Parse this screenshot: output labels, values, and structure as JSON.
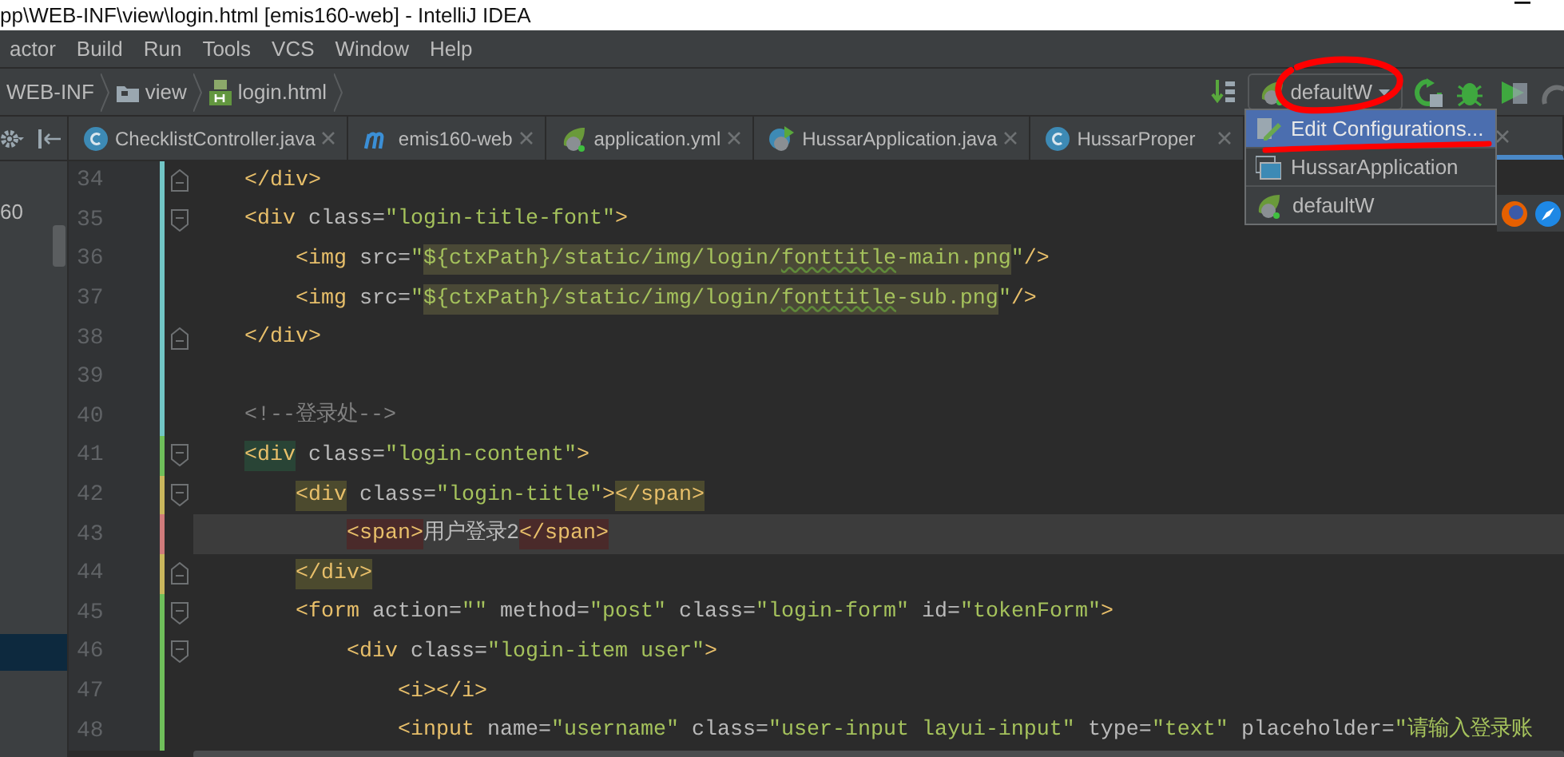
{
  "window": {
    "title": "pp\\WEB-INF\\view\\login.html [emis160-web] - IntelliJ IDEA"
  },
  "menu": [
    "actor",
    "Build",
    "Run",
    "Tools",
    "VCS",
    "Window",
    "Help"
  ],
  "breadcrumbs": [
    {
      "label": "WEB-INF"
    },
    {
      "label": "view",
      "kind": "folder"
    },
    {
      "label": "login.html",
      "kind": "html"
    }
  ],
  "run_config": {
    "label": "defaultW"
  },
  "project_panel": {
    "rows": [
      {
        "label": "60",
        "selected": false
      },
      {
        "selected": false
      },
      {
        "selected": false
      },
      {
        "selected": false
      },
      {
        "selected": false
      },
      {
        "selected": false
      },
      {
        "selected": false
      },
      {
        "selected": false
      },
      {
        "selected": false
      },
      {
        "selected": false
      },
      {
        "selected": false
      },
      {
        "selected": false
      },
      {
        "selected": true
      }
    ]
  },
  "tabs": [
    {
      "label": "ChecklistController.java",
      "kind": "class",
      "selected": false
    },
    {
      "label": "emis160-web",
      "kind": "module",
      "selected": false
    },
    {
      "label": "application.yml",
      "kind": "spring",
      "selected": false
    },
    {
      "label": "HussarApplication.java",
      "kind": "spring-app",
      "selected": false
    },
    {
      "label": "HussarProper",
      "kind": "class",
      "selected": false
    },
    {
      "selected": true
    }
  ],
  "editor": {
    "lines": [
      {
        "number": "34",
        "color": "#72c6c6",
        "kind": "fold-end",
        "current": false,
        "segments": [
          {
            "kind": "tag",
            "text": "    </div>"
          }
        ]
      },
      {
        "number": "35",
        "color": "#72c6c6",
        "kind": "fold-start",
        "current": false,
        "segments": [
          {
            "kind": "tag",
            "text": "    <div"
          },
          {
            "kind": "attr",
            "text": " class="
          },
          {
            "kind": "str",
            "text": "\"login-title-font\""
          },
          {
            "kind": "tag",
            "text": ">"
          }
        ]
      },
      {
        "number": "36",
        "color": "#72c6c6",
        "kind": "plain",
        "current": false,
        "segments": [
          {
            "kind": "tag",
            "text": "        <img"
          },
          {
            "kind": "attr",
            "text": " src="
          },
          {
            "kind": "str",
            "text": "\""
          },
          {
            "kind": "str-injected",
            "text": "${ctxPath}/static/img/login/"
          },
          {
            "kind": "str-typo",
            "text": "fonttitle"
          },
          {
            "kind": "str-injected",
            "text": "-main.png"
          },
          {
            "kind": "str",
            "text": "\""
          },
          {
            "kind": "tag",
            "text": "/>"
          }
        ]
      },
      {
        "number": "37",
        "color": "#72c6c6",
        "kind": "plain",
        "current": false,
        "segments": [
          {
            "kind": "tag",
            "text": "        <img"
          },
          {
            "kind": "attr",
            "text": " src="
          },
          {
            "kind": "str",
            "text": "\""
          },
          {
            "kind": "str-injected",
            "text": "${ctxPath}/static/img/login/"
          },
          {
            "kind": "str-typo",
            "text": "fonttitle"
          },
          {
            "kind": "str-injected",
            "text": "-sub.png"
          },
          {
            "kind": "str",
            "text": "\""
          },
          {
            "kind": "tag",
            "text": "/>"
          }
        ]
      },
      {
        "number": "38",
        "color": "#72c6c6",
        "kind": "fold-end",
        "current": false,
        "segments": [
          {
            "kind": "tag",
            "text": "    </div>"
          }
        ]
      },
      {
        "number": "39",
        "color": "#72c6c6",
        "kind": "plain",
        "current": false
      },
      {
        "number": "40",
        "color": "#72c6c6",
        "kind": "plain",
        "current": false,
        "segments": [
          {
            "kind": "comment",
            "text": "    <!--登录处-->"
          }
        ]
      },
      {
        "number": "41",
        "color": "#6fbf5a",
        "kind": "fold-start",
        "current": false,
        "segments": [
          {
            "kind": "tag-brace",
            "text": "    <div"
          },
          {
            "kind": "attr",
            "text": " class="
          },
          {
            "kind": "str",
            "text": "\"login-content\""
          },
          {
            "kind": "tag",
            "text": ">"
          }
        ]
      },
      {
        "number": "42",
        "color": "#c9b65c",
        "kind": "fold-start",
        "current": false,
        "segments": [
          {
            "kind": "tag-match",
            "text": "        <div"
          },
          {
            "kind": "attr",
            "text": " class="
          },
          {
            "kind": "str",
            "text": "\"login-title\""
          },
          {
            "kind": "tag",
            "text": ">"
          },
          {
            "kind": "tag-match",
            "text": "</span>"
          }
        ]
      },
      {
        "number": "43",
        "color": "#d07b7b",
        "kind": "plain",
        "current": true,
        "segments": [
          {
            "kind": "tag-error",
            "text": "            <span>"
          },
          {
            "kind": "text",
            "text": "用户登录2"
          },
          {
            "kind": "tag-error",
            "text": "</span>"
          }
        ]
      },
      {
        "number": "44",
        "color": "#c9b65c",
        "kind": "fold-end",
        "current": false,
        "segments": [
          {
            "kind": "tag-match",
            "text": "        </div>"
          }
        ]
      },
      {
        "number": "45",
        "color": "#6fbf5a",
        "kind": "fold-start",
        "current": false,
        "segments": [
          {
            "kind": "tag",
            "text": "        <form"
          },
          {
            "kind": "attr",
            "text": " action="
          },
          {
            "kind": "str",
            "text": "\"\""
          },
          {
            "kind": "attr",
            "text": " method="
          },
          {
            "kind": "str",
            "text": "\"post\""
          },
          {
            "kind": "attr",
            "text": " class="
          },
          {
            "kind": "str",
            "text": "\"login-form\""
          },
          {
            "kind": "attr",
            "text": " id="
          },
          {
            "kind": "str",
            "text": "\"tokenForm\""
          },
          {
            "kind": "tag",
            "text": ">"
          }
        ]
      },
      {
        "number": "46",
        "color": "#6fbf5a",
        "kind": "fold-start",
        "current": false,
        "segments": [
          {
            "kind": "tag",
            "text": "            <div"
          },
          {
            "kind": "attr",
            "text": " class="
          },
          {
            "kind": "str",
            "text": "\"login-item user\""
          },
          {
            "kind": "tag",
            "text": ">"
          }
        ]
      },
      {
        "number": "47",
        "color": "#6fbf5a",
        "kind": "plain",
        "current": false,
        "segments": [
          {
            "kind": "tag",
            "text": "                <i></i>"
          }
        ]
      },
      {
        "number": "48",
        "color": "#6fbf5a",
        "kind": "plain",
        "current": false,
        "segments": [
          {
            "kind": "tag",
            "text": "                <input"
          },
          {
            "kind": "attr",
            "text": " name="
          },
          {
            "kind": "str",
            "text": "\"username\""
          },
          {
            "kind": "attr",
            "text": " class="
          },
          {
            "kind": "str",
            "text": "\"user-input layui-input\""
          },
          {
            "kind": "attr",
            "text": " type="
          },
          {
            "kind": "str",
            "text": "\"text\""
          },
          {
            "kind": "attr",
            "text": " placeholder="
          },
          {
            "kind": "str",
            "text": "\"请输入登录账"
          }
        ]
      }
    ]
  },
  "run_menu": {
    "items": [
      {
        "label": "Edit Configurations...",
        "kind": "edit",
        "selected": true
      },
      {
        "label": "HussarApplication",
        "kind": "app",
        "selected": false
      },
      {
        "label": "defaultW",
        "kind": "spring",
        "selected": false
      }
    ]
  }
}
